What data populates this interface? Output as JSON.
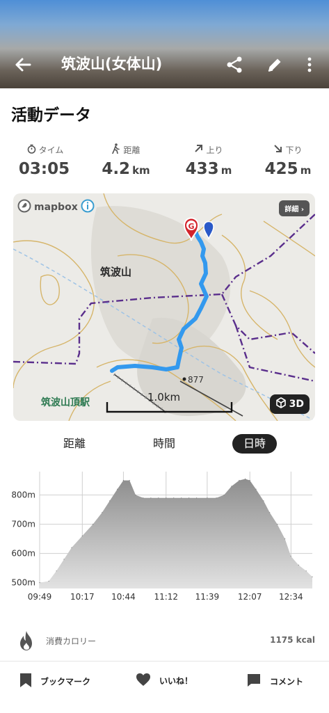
{
  "header": {
    "title": "筑波山(女体山)"
  },
  "section_title": "活動データ",
  "stats": [
    {
      "label": "タイム",
      "value": "03:05",
      "unit": "",
      "icon": "stopwatch-icon"
    },
    {
      "label": "距離",
      "value": "4.2",
      "unit": "km",
      "icon": "hiker-icon"
    },
    {
      "label": "上り",
      "value": "433",
      "unit": "m",
      "icon": "arrow-up-right-icon"
    },
    {
      "label": "下り",
      "value": "425",
      "unit": "m",
      "icon": "arrow-down-right-icon"
    }
  ],
  "map": {
    "attribution": "mapbox",
    "detail_button": "詳細",
    "btn_3d": "3D",
    "peak_label": "筑波山",
    "station_label": "筑波山頂駅",
    "elevation_marker": "877",
    "scale": "1.0km",
    "goal_marker": "G",
    "route_color": "#3399ee",
    "goal_color": "#d3242c"
  },
  "tabs": [
    {
      "label": "距離",
      "active": false
    },
    {
      "label": "時間",
      "active": false
    },
    {
      "label": "日時",
      "active": true
    }
  ],
  "chart_data": {
    "type": "area",
    "x": [
      "09:49",
      "09:55",
      "10:00",
      "10:05",
      "10:10",
      "10:17",
      "10:24",
      "10:30",
      "10:35",
      "10:40",
      "10:44",
      "10:48",
      "10:52",
      "10:57",
      "11:02",
      "11:07",
      "11:12",
      "11:17",
      "11:22",
      "11:27",
      "11:32",
      "11:39",
      "11:45",
      "11:50",
      "11:55",
      "12:00",
      "12:04",
      "12:07",
      "12:11",
      "12:16",
      "12:20",
      "12:25",
      "12:30",
      "12:34",
      "12:39",
      "12:44",
      "12:48"
    ],
    "y": [
      500,
      505,
      540,
      580,
      620,
      660,
      700,
      740,
      780,
      820,
      850,
      850,
      800,
      790,
      790,
      790,
      790,
      790,
      790,
      790,
      790,
      790,
      790,
      800,
      830,
      850,
      855,
      850,
      820,
      780,
      740,
      700,
      650,
      590,
      560,
      540,
      520
    ],
    "x_ticks": [
      "09:49",
      "10:17",
      "10:44",
      "11:12",
      "11:39",
      "12:07",
      "12:34"
    ],
    "y_ticks": [
      "500m",
      "600m",
      "700m",
      "800m"
    ],
    "ylim": [
      480,
      880
    ],
    "grid": true,
    "fill_color": "#8e8e8e",
    "xlabel": "",
    "ylabel": ""
  },
  "calories": {
    "label": "消費カロリー",
    "value": "1175 kcal"
  },
  "bottom_bar": {
    "bookmark": "ブックマーク",
    "like": "いいね！",
    "comment": "コメント"
  }
}
